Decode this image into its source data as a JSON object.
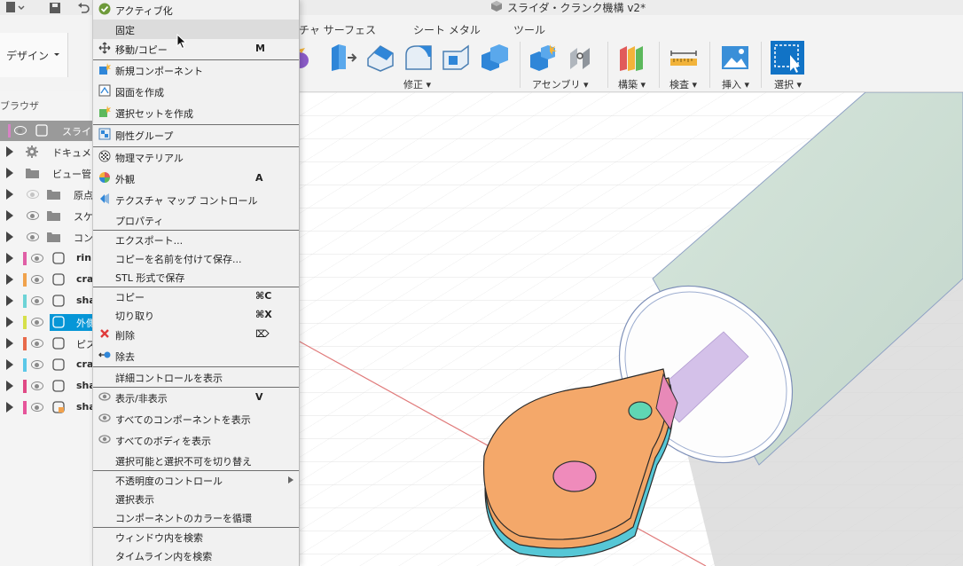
{
  "document_title": "スライダ・クランク機構 v2*",
  "workspace_button": "デザイン",
  "ribbon": {
    "tabs": [
      "チャ サーフェス",
      "シート メタル",
      "ツール"
    ],
    "groups": {
      "modify": "修正",
      "assemble": "アセンブリ",
      "construct": "構築",
      "inspect": "検査",
      "insert": "挿入",
      "select": "選択"
    }
  },
  "browser": {
    "title": "ブラウザ",
    "root_label": "スライ",
    "rows": [
      {
        "label": "ドキュメ",
        "bold": false,
        "color": ""
      },
      {
        "label": "ビュー管",
        "bold": false,
        "color": ""
      },
      {
        "label": "原点",
        "bold": false,
        "color": ""
      },
      {
        "label": "スケ",
        "bold": false,
        "color": ""
      },
      {
        "label": "コン",
        "bold": false,
        "color": ""
      },
      {
        "label": "rin",
        "bold": true,
        "color": "#e05fa6"
      },
      {
        "label": "cra",
        "bold": true,
        "color": "#f0a24c"
      },
      {
        "label": "sha",
        "bold": true,
        "color": "#6dd3d6"
      },
      {
        "label": "外側",
        "bold": true,
        "color": "#d6e04a"
      },
      {
        "label": "ピス",
        "bold": false,
        "color": "#e86a4a"
      },
      {
        "label": "cra",
        "bold": true,
        "color": "#5cc8e8"
      },
      {
        "label": "sha",
        "bold": true,
        "color": "#e04a86"
      },
      {
        "label": "sha",
        "bold": true,
        "color": "#e6559a"
      }
    ]
  },
  "context_menu": {
    "items": [
      {
        "label": "アクティブ化",
        "key": ""
      },
      {
        "label": "固定",
        "key": ""
      },
      {
        "label": "移動/コピー",
        "key": "M"
      },
      {
        "label": "新規コンポーネント",
        "key": ""
      },
      {
        "label": "図面を作成",
        "key": ""
      },
      {
        "label": "選択セットを作成",
        "key": ""
      },
      {
        "label": "剛性グループ",
        "key": ""
      },
      {
        "label": "物理マテリアル",
        "key": ""
      },
      {
        "label": "外観",
        "key": "A"
      },
      {
        "label": "テクスチャ マップ コントロール",
        "key": ""
      },
      {
        "label": "プロパティ",
        "key": ""
      },
      {
        "label": "エクスポート...",
        "key": ""
      },
      {
        "label": "コピーを名前を付けて保存...",
        "key": ""
      },
      {
        "label": "STL 形式で保存",
        "key": ""
      },
      {
        "label": "コピー",
        "key": "⌘C"
      },
      {
        "label": "切り取り",
        "key": "⌘X"
      },
      {
        "label": "削除",
        "key": "⌦"
      },
      {
        "label": "除去",
        "key": ""
      },
      {
        "label": "詳細コントロールを表示",
        "key": ""
      },
      {
        "label": "表示/非表示",
        "key": "V"
      },
      {
        "label": "すべてのコンポーネントを表示",
        "key": ""
      },
      {
        "label": "すべてのボディを表示",
        "key": ""
      },
      {
        "label": "選択可能と選択不可を切り替え",
        "key": ""
      },
      {
        "label": "不透明度のコントロール",
        "key": ""
      },
      {
        "label": "選択表示",
        "key": ""
      },
      {
        "label": "コンポーネントのカラーを循環",
        "key": ""
      },
      {
        "label": "ウィンドウ内を検索",
        "key": ""
      },
      {
        "label": "タイムライン内を検索",
        "key": ""
      }
    ]
  },
  "colors": {
    "accent_blue": "#1a73d9",
    "select_highlight": "#0696d7",
    "orange_part": "#f2a566",
    "cyan_part": "#56c7d6",
    "pink_pin": "#ef8bbb",
    "teal_pin": "#5fd6b4",
    "cylinder": "#cfe0d6"
  }
}
